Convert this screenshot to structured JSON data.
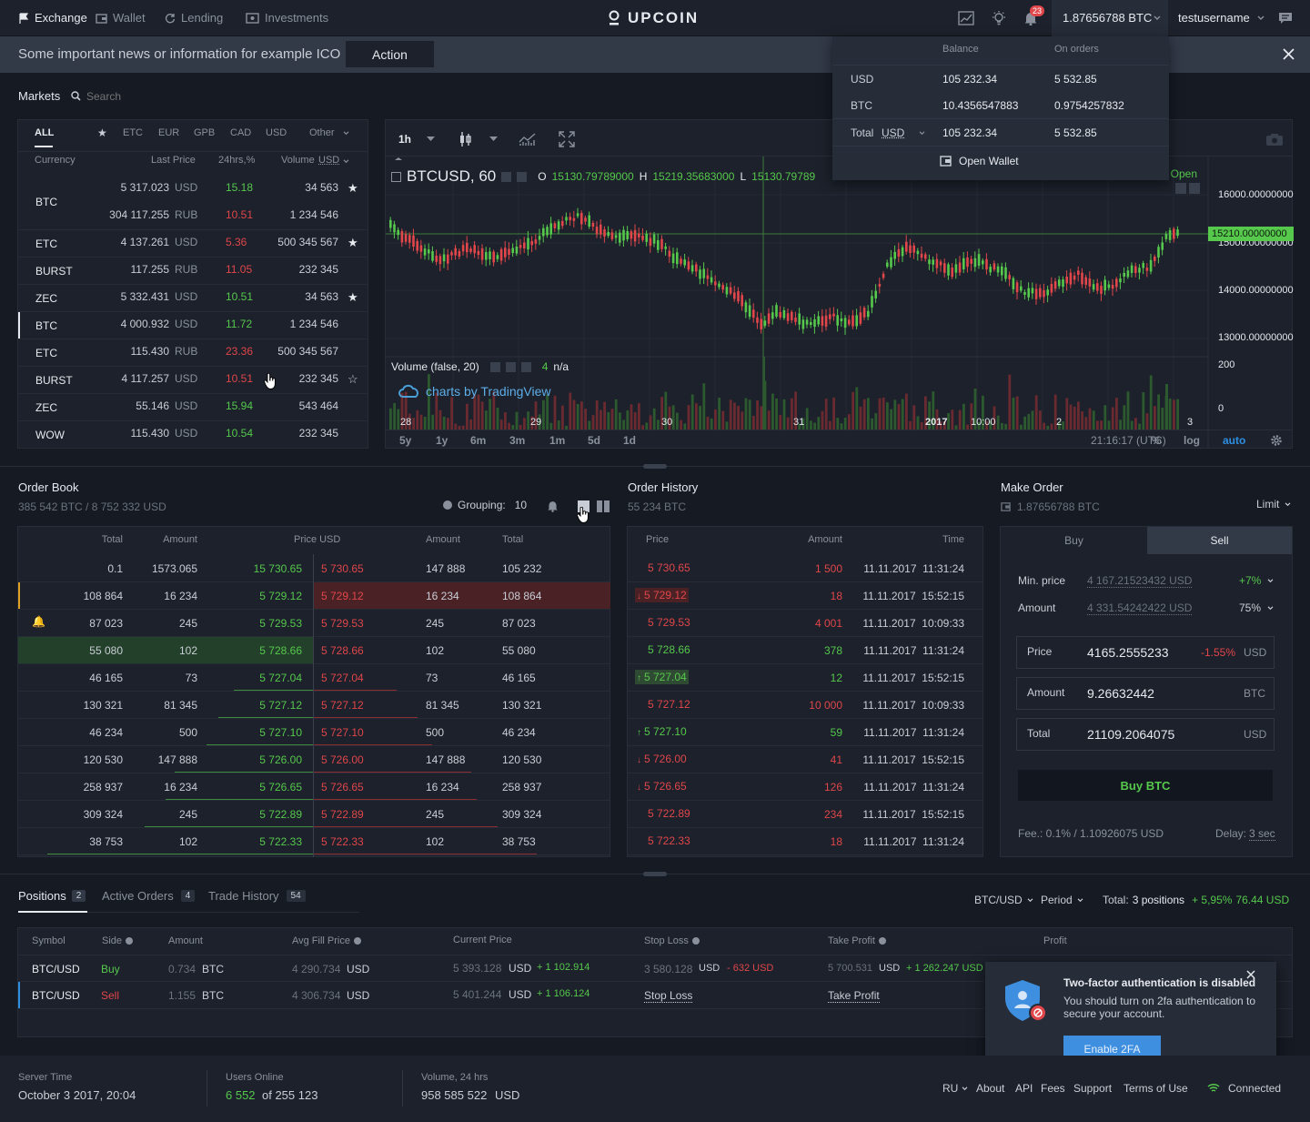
{
  "topbar": {
    "nav": [
      {
        "label": "Exchange",
        "icon": "flag-icon"
      },
      {
        "label": "Wallet",
        "icon": "wallet-icon"
      },
      {
        "label": "Lending",
        "icon": "refresh-icon"
      },
      {
        "label": "Investments",
        "icon": "investments-icon"
      }
    ],
    "logo": "UPCOIN",
    "notifications_count": "23",
    "balance": "1.87656788 BTC",
    "username": "testusername"
  },
  "news": {
    "text": "Some important news or information for example ICO",
    "action_label": "Action"
  },
  "balance_dropdown": {
    "headers": [
      "Balance",
      "On orders"
    ],
    "rows": [
      {
        "currency": "USD",
        "balance": "105 232.34",
        "on_orders": "5 532.85"
      },
      {
        "currency": "BTC",
        "balance": "10.4356547883",
        "on_orders": "0.9754257832"
      }
    ],
    "total_label": "Total",
    "total_currency": "USD",
    "total_balance": "105 232.34",
    "total_orders": "5 532.85",
    "open_wallet": "Open Wallet"
  },
  "markets": {
    "title": "Markets",
    "search_placeholder": "Search",
    "tabs": [
      "ALL",
      "ETC",
      "EUR",
      "GPB",
      "CAD",
      "USD",
      "Other"
    ],
    "headers": {
      "currency": "Currency",
      "last_price": "Last Price",
      "change": "24hrs,%",
      "volume": "Volume",
      "volume_currency": "USD"
    },
    "rows": [
      {
        "currency": "BTC",
        "price": "5 317.023",
        "unit": "USD",
        "change": "15.18",
        "dir": "up",
        "volume": "34 563",
        "star": "filled",
        "price2": "304 117.255",
        "unit2": "RUB",
        "change2": "10.51",
        "volume2": "1 234 546"
      },
      {
        "currency": "ETC",
        "price": "4 137.261",
        "unit": "USD",
        "change": "5.36",
        "dir": "down",
        "volume": "500 345 567",
        "star": "filled"
      },
      {
        "currency": "BURST",
        "price": "117.255",
        "unit": "RUB",
        "change": "11.05",
        "dir": "down",
        "volume": "232 345",
        "star": ""
      },
      {
        "currency": "ZEC",
        "price": "5 332.431",
        "unit": "USD",
        "change": "10.51",
        "dir": "up",
        "volume": "34 563",
        "star": "filled"
      },
      {
        "currency": "BTC",
        "price": "4 000.932",
        "unit": "USD",
        "change": "11.72",
        "dir": "up",
        "volume": "1 234 546",
        "star": ""
      },
      {
        "currency": "ETC",
        "price": "115.430",
        "unit": "RUB",
        "change": "23.36",
        "dir": "down",
        "volume": "500 345 567",
        "star": ""
      },
      {
        "currency": "BURST",
        "price": "4 117.257",
        "unit": "USD",
        "change": "10.51",
        "dir": "down",
        "volume": "232 345",
        "star": "outline"
      },
      {
        "currency": "ZEC",
        "price": "55.146",
        "unit": "USD",
        "change": "15.94",
        "dir": "up",
        "volume": "543 464",
        "star": ""
      },
      {
        "currency": "WOW",
        "price": "115.430",
        "unit": "USD",
        "change": "10.54",
        "dir": "up",
        "volume": "232 345",
        "star": ""
      }
    ]
  },
  "chart": {
    "interval": "1h",
    "symbol": "BTCUSD, 60",
    "ohlc_o_label": "O",
    "ohlc_o": "15130.79789000",
    "ohlc_h_label": "H",
    "ohlc_h": "15219.35683000",
    "ohlc_l_label": "L",
    "ohlc_l": "15130.79789",
    "open_label": "t Open",
    "price_axis": [
      "16000.00000000",
      "15000.00000000",
      "14000.00000000",
      "13000.00000000"
    ],
    "current_price": "15210.00000000",
    "volume_label": "Volume (false, 20)",
    "volume_value": "4",
    "volume_na": "n/a",
    "volume_axis": [
      "200",
      "0"
    ],
    "watermark": "charts by TradingView",
    "time_axis": [
      "28",
      "29",
      "30",
      "31",
      "2017",
      "10:00",
      "2",
      "3"
    ],
    "ranges": [
      "5y",
      "1y",
      "6m",
      "3m",
      "1m",
      "5d",
      "1d"
    ],
    "clock": "21:16:17 (UTC)",
    "options": [
      "%",
      "log",
      "auto"
    ]
  },
  "order_book": {
    "title": "Order Book",
    "subtitle": "385 542 BTC  /  8 752 332 USD",
    "grouping_label": "Grouping:",
    "grouping_value": "10",
    "headers": [
      "Total",
      "Amount",
      "Price USD",
      "Amount",
      "Total"
    ],
    "rows": [
      {
        "btotal": "0.1",
        "bamount": "1573.065",
        "bprice": "15 730.65",
        "sprice": "5 730.65",
        "samount": "147 888",
        "stotal": "105 232",
        "bfill": 0.0,
        "sfill": 0.0
      },
      {
        "btotal": "108 864",
        "bamount": "16 234",
        "bprice": "5 729.12",
        "sprice": "5 729.12",
        "samount": "16 234",
        "stotal": "108 864",
        "bfill": 0.0,
        "sfill": 1.0
      },
      {
        "btotal": "87 023",
        "bamount": "245",
        "bprice": "5 729.53",
        "sprice": "5 729.53",
        "samount": "245",
        "stotal": "87 023",
        "bfill": 0.0,
        "sfill": 0.0
      },
      {
        "btotal": "55 080",
        "bamount": "102",
        "bprice": "5 728.66",
        "sprice": "5 728.66",
        "samount": "102",
        "stotal": "55 080",
        "bfill": 1.0,
        "sfill": 0.0
      },
      {
        "btotal": "46 165",
        "bamount": "73",
        "bprice": "5 727.04",
        "sprice": "5 727.04",
        "samount": "73",
        "stotal": "46 165",
        "bfill": 0.27,
        "sfill": 0.28
      },
      {
        "btotal": "130 321",
        "bamount": "81 345",
        "bprice": "5 727.12",
        "sprice": "5 727.12",
        "samount": "81 345",
        "stotal": "130 321",
        "bfill": 0.32,
        "sfill": 0.35
      },
      {
        "btotal": "46 234",
        "bamount": "500",
        "bprice": "5 727.10",
        "sprice": "5 727.10",
        "samount": "500",
        "stotal": "46 234",
        "bfill": 0.36,
        "sfill": 0.4
      },
      {
        "btotal": "120 530",
        "bamount": "147 888",
        "bprice": "5 726.00",
        "sprice": "5 726.00",
        "samount": "147 888",
        "stotal": "120 530",
        "bfill": 0.47,
        "sfill": 0.53
      },
      {
        "btotal": "258 937",
        "bamount": "16 234",
        "bprice": "5 726.65",
        "sprice": "5 726.65",
        "samount": "16 234",
        "stotal": "258 937",
        "bfill": 0.5,
        "sfill": 0.55
      },
      {
        "btotal": "309 324",
        "bamount": "245",
        "bprice": "5 722.89",
        "sprice": "5 722.89",
        "samount": "245",
        "stotal": "309 324",
        "bfill": 0.57,
        "sfill": 0.62
      },
      {
        "btotal": "38 753",
        "bamount": "102",
        "bprice": "5 722.33",
        "sprice": "5 722.33",
        "samount": "102",
        "stotal": "38 753",
        "bfill": 0.9,
        "sfill": 0.75
      }
    ]
  },
  "order_history": {
    "title": "Order History",
    "subtitle": "55 234 BTC",
    "headers": [
      "Price",
      "Amount",
      "Time"
    ],
    "rows": [
      {
        "price": "5 730.65",
        "side": "sell",
        "arrow": "",
        "amount": "1 500",
        "time": "11.11.2017  11:31:24"
      },
      {
        "price": "5 729.12",
        "side": "sell",
        "arrow": "down",
        "amount": "18",
        "time": "11.11.2017  15:52:15",
        "hl": true
      },
      {
        "price": "5 729.53",
        "side": "sell",
        "arrow": "",
        "amount": "4 001",
        "time": "11.11.2017  10:09:33"
      },
      {
        "price": "5 728.66",
        "side": "buy",
        "arrow": "",
        "amount": "378",
        "time": "11.11.2017  11:31:24"
      },
      {
        "price": "5 727.04",
        "side": "buy",
        "arrow": "up",
        "amount": "12",
        "time": "11.11.2017  15:52:15",
        "hl": true
      },
      {
        "price": "5 727.12",
        "side": "sell",
        "arrow": "",
        "amount": "10 000",
        "time": "11.11.2017  10:09:33"
      },
      {
        "price": "5 727.10",
        "side": "buy",
        "arrow": "up",
        "amount": "59",
        "time": "11.11.2017  11:31:24"
      },
      {
        "price": "5 726.00",
        "side": "sell",
        "arrow": "down",
        "amount": "41",
        "time": "11.11.2017  15:52:15"
      },
      {
        "price": "5 726.65",
        "side": "sell",
        "arrow": "down",
        "amount": "126",
        "time": "11.11.2017  11:31:24"
      },
      {
        "price": "5 722.89",
        "side": "sell",
        "arrow": "",
        "amount": "234",
        "time": "11.11.2017  15:52:15"
      },
      {
        "price": "5 722.33",
        "side": "sell",
        "arrow": "",
        "amount": "18",
        "time": "11.11.2017  11:31:24"
      }
    ]
  },
  "make_order": {
    "title": "Make Order",
    "balance": "1.87656788 BTC",
    "type": "Limit",
    "tabs": [
      "Buy",
      "Sell"
    ],
    "min_price_label": "Min. price",
    "min_price": "4 167.21523432 USD",
    "min_price_pct": "+7%",
    "amount_label": "Amount",
    "amount_hint": "4 331.54242422 USD",
    "amount_pct": "75%",
    "price_label": "Price",
    "price_value": "4165.2555233",
    "price_change": "-1.55%",
    "price_unit": "USD",
    "amount_field_label": "Amount",
    "amount_value": "9.26632442",
    "amount_unit": "BTC",
    "total_label": "Total",
    "total_value": "21109.2064075",
    "total_unit": "USD",
    "submit": "Buy BTC",
    "fee": "Fee.: 0.1% / 1.10926075 USD",
    "delay_label": "Delay:",
    "delay_value": "3 sec"
  },
  "positions": {
    "tabs": [
      {
        "label": "Positions",
        "count": "2"
      },
      {
        "label": "Active Orders",
        "count": "4"
      },
      {
        "label": "Trade History",
        "count": "54"
      }
    ],
    "pair": "BTC/USD",
    "period": "Period",
    "total_label": "Total:",
    "total_positions": "3 positions",
    "total_pct": "+ 5,95%",
    "total_value": "76.44  USD",
    "headers": [
      "Symbol",
      "Side",
      "Amount",
      "Avg Fill Price",
      "Current Price",
      "Stop Loss",
      "Take Profit",
      "Profit"
    ],
    "rows": [
      {
        "symbol": "BTC/USD",
        "side": "Buy",
        "amount": "0.734",
        "amount_unit": "BTC",
        "avg": "4 290.734",
        "avg_unit": "USD",
        "cur": "5 393.128",
        "cur_unit": "USD",
        "cur_diff": "+ 1 102.914",
        "sl": "3 580.128",
        "sl_unit": "USD",
        "sl_diff": "- 632 USD",
        "tp": "5 700.531",
        "tp_unit": "USD",
        "tp_diff": "+ 1 262.247 USD"
      },
      {
        "symbol": "BTC/USD",
        "side": "Sell",
        "amount": "1.155",
        "amount_unit": "BTC",
        "avg": "4 306.734",
        "avg_unit": "USD",
        "cur": "5 401.244",
        "cur_unit": "USD",
        "cur_diff": "+ 1 106.124",
        "sl_link": "Stop Loss",
        "tp_link": "Take Profit"
      }
    ]
  },
  "twofa": {
    "title": "Two-factor authentication is disabled",
    "text": "You should turn on 2fa authentication to secure your account.",
    "button": "Enable 2FA"
  },
  "footer": {
    "server_time_label": "Server Time",
    "server_time": "October 3 2017, 20:04",
    "users_label": "Users Online",
    "users_online": "6 552",
    "users_of": "of 255 123",
    "volume_label": "Volume, 24 hrs",
    "volume": "958 585 522",
    "volume_unit": "USD",
    "links": [
      "RU",
      "About",
      "API",
      "Fees",
      "Support",
      "Terms of Use"
    ],
    "status": "Connected"
  }
}
